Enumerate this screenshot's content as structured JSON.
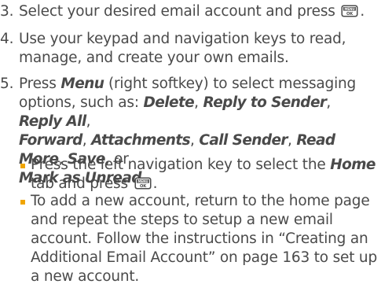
{
  "step3": {
    "number": "3.",
    "text": "Select your desired email account and press",
    "end": "."
  },
  "step4": {
    "number": "4.",
    "line1": "Use your keypad and navigation keys to read,",
    "line2": "manage, and create your own emails."
  },
  "step5": {
    "number": "5.",
    "p1": "Press",
    "menu": "Menu",
    "p2": " (right softkey) to select messaging",
    "p3": "options, such as:",
    "opt_delete": "Delete",
    "opt_reply_sender": "Reply to Sender",
    "opt_reply_all": "Reply All",
    "opt_forward": "Forward",
    "opt_attachments": "Attachments",
    "opt_call_sender": "Call Sender",
    "opt_read_more": "Read More",
    "opt_save": "Save",
    "or": "or",
    "opt_mark_unread": "Mark as Unread"
  },
  "bullet1": {
    "p1": "Press the left navigation key to select the",
    "home": "Home",
    "p2": "tab and press",
    "end": "."
  },
  "bullet2": {
    "line1": "To add a new account, return to the home page",
    "line2": "and repeat the steps to setup a new email",
    "line3": "account. Follow the instructions in “Creating an",
    "line4": "Additional Email Account” on page 163 to set up",
    "line5": "a new account."
  },
  "key_icon": {
    "name": "menu-ok-key-icon",
    "top_label": "MENU",
    "bottom_label": "OK"
  },
  "colors": {
    "text": "#4a4a4a",
    "bullet": "#f0a500"
  }
}
